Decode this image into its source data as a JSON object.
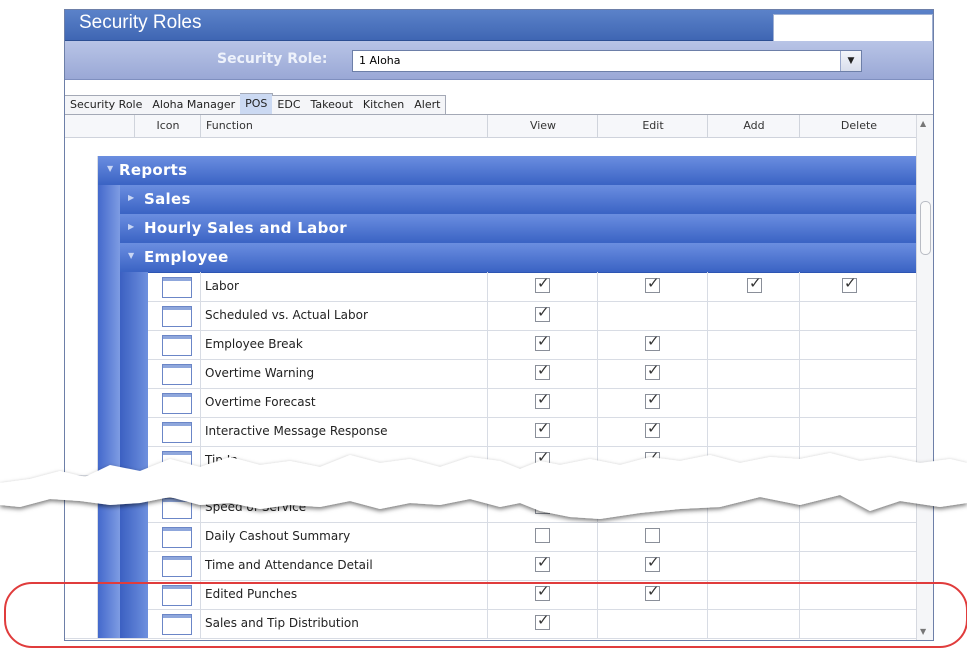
{
  "window": {
    "title": "Security Roles"
  },
  "role_bar": {
    "label": "Security Role:",
    "selected": "1 Aloha"
  },
  "tabs": [
    {
      "label": "Security Role",
      "active": false
    },
    {
      "label": "Aloha Manager",
      "active": false
    },
    {
      "label": "POS",
      "active": true
    },
    {
      "label": "EDC",
      "active": false
    },
    {
      "label": "Takeout",
      "active": false
    },
    {
      "label": "Kitchen",
      "active": false
    },
    {
      "label": "Alert",
      "active": false
    }
  ],
  "columns": {
    "icon": "Icon",
    "function": "Function",
    "view": "View",
    "edit": "Edit",
    "add": "Add",
    "delete": "Delete"
  },
  "groups": {
    "reports": "Reports",
    "sales": "Sales",
    "hourly": "Hourly Sales and Labor",
    "employee": "Employee"
  },
  "rows_top": [
    {
      "function": "Labor",
      "view": true,
      "edit": true,
      "add": true,
      "delete": true
    },
    {
      "function": "Scheduled vs. Actual Labor",
      "view": true,
      "edit": null,
      "add": null,
      "delete": null
    },
    {
      "function": "Employee Break",
      "view": true,
      "edit": true,
      "add": null,
      "delete": null
    },
    {
      "function": "Overtime Warning",
      "view": true,
      "edit": true,
      "add": null,
      "delete": null
    },
    {
      "function": "Overtime Forecast",
      "view": true,
      "edit": true,
      "add": null,
      "delete": null
    },
    {
      "function": "Interactive Message Response",
      "view": true,
      "edit": true,
      "add": null,
      "delete": null
    },
    {
      "function": "Tip In...",
      "view": true,
      "edit": true,
      "add": null,
      "delete": null
    }
  ],
  "rows_bottom": [
    {
      "function": "Speed of Service",
      "view": true,
      "edit": null,
      "add": null,
      "delete": null
    },
    {
      "function": "Daily Cashout Summary",
      "view": false,
      "edit": false,
      "add": null,
      "delete": null
    },
    {
      "function": "Time and Attendance Detail",
      "view": true,
      "edit": true,
      "add": null,
      "delete": null
    },
    {
      "function": "Edited Punches",
      "view": true,
      "edit": true,
      "add": null,
      "delete": null
    },
    {
      "function": "Sales and Tip Distribution",
      "view": true,
      "edit": null,
      "add": null,
      "delete": null
    }
  ],
  "colors": {
    "title_bar": "#4a72c0",
    "group_row": "#4f78d6",
    "callout": "#e03c3c"
  }
}
